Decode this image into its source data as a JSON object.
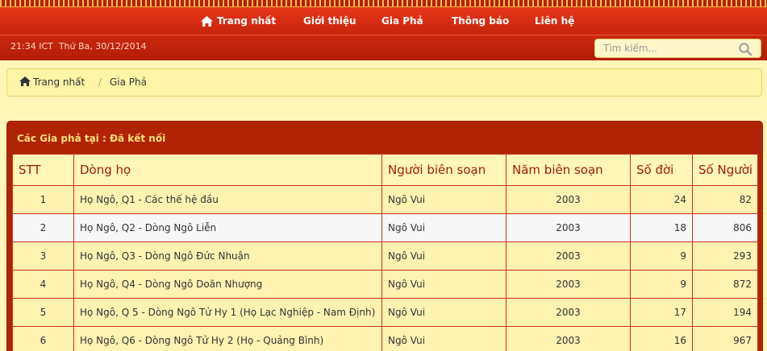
{
  "nav": {
    "items": [
      {
        "label": "Trang nhất",
        "icon": "home-icon"
      },
      {
        "label": "Giới thiệu"
      },
      {
        "label": "Gia Phả"
      },
      {
        "label": "Thông báo"
      },
      {
        "label": "Liên hệ"
      }
    ]
  },
  "status": {
    "datetime": "21:34 ICT  Thứ Ba, 30/12/2014"
  },
  "search": {
    "placeholder": "Tìm kiếm...",
    "icon": "search-icon"
  },
  "breadcrumb": {
    "home": "Trang nhất",
    "separator": "/",
    "current": "Gia Phả"
  },
  "panel": {
    "title": "Các Gia phả tại : Đã kết nối"
  },
  "table": {
    "headers": [
      "STT",
      "Dòng họ",
      "Người biên soạn",
      "Năm biên soạn",
      "Số đời",
      "Số Người"
    ],
    "rows": [
      [
        "1",
        "Họ Ngô, Q1 - Các thế hệ đầu",
        "Ngô Vui",
        "2003",
        "24",
        "82"
      ],
      [
        "2",
        "Họ Ngô, Q2 - Dòng Ngô Liễn",
        "Ngô Vui",
        "2003",
        "18",
        "806"
      ],
      [
        "3",
        "Họ Ngô, Q3 - Dòng Ngô Đức Nhuận",
        "Ngô Vui",
        "2003",
        "9",
        "293"
      ],
      [
        "4",
        "Họ Ngô, Q4 - Dòng Ngô Doãn Nhượng",
        "Ngô Vui",
        "2003",
        "9",
        "872"
      ],
      [
        "5",
        "Họ Ngô, Q 5 - Dòng Ngô Tử Hy 1 (Họ Lạc Nghiệp - Nam Định)",
        "Ngô Vui",
        "2003",
        "17",
        "194"
      ],
      [
        "6",
        "Họ Ngô, Q6 - Dòng Ngô Tử Hy 2 (Họ - Quảng Bình)",
        "Ngô Vui",
        "2003",
        "16",
        "967"
      ]
    ]
  },
  "colors": {
    "header_red": "#c8240d",
    "panel_red": "#b02405",
    "cream": "#fff6b8",
    "title_text": "#9f1a05"
  }
}
